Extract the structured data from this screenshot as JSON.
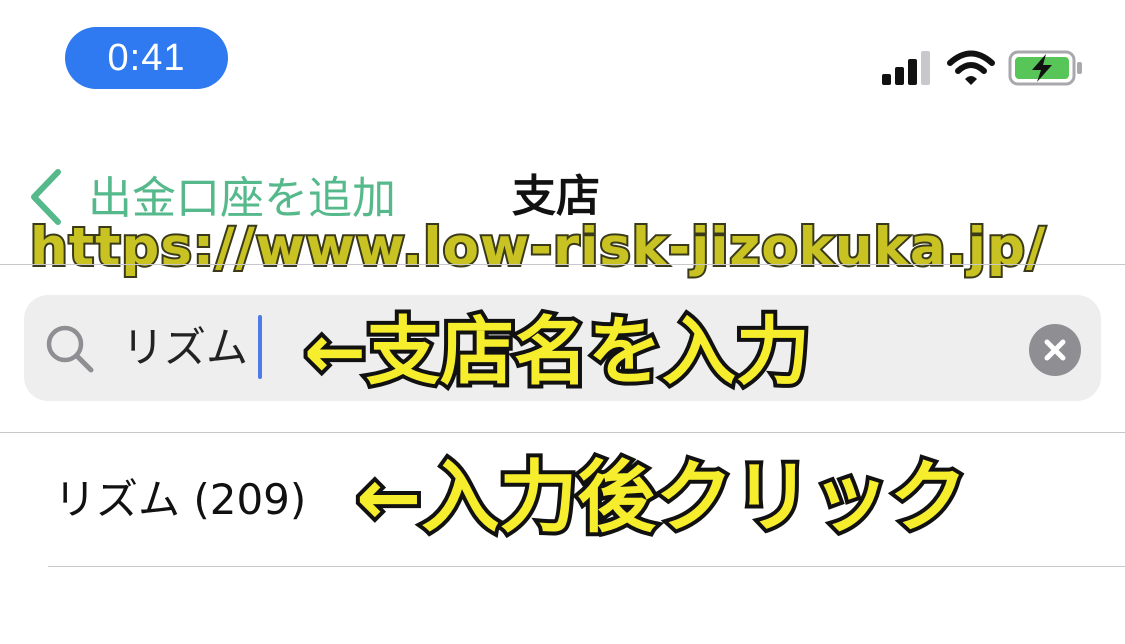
{
  "status_bar": {
    "time": "0:41",
    "icons": [
      "cellular-signal-icon",
      "wifi-icon",
      "battery-charging-icon"
    ],
    "time_pill_color": "#2f7af0"
  },
  "nav": {
    "back_label": "出金口座を追加",
    "title": "支店",
    "accent_color": "#55b98b"
  },
  "watermark": {
    "text": "https://www.low-risk-jizokuka.jp/"
  },
  "search": {
    "value": "リズム",
    "icon": "search-icon",
    "clear_icon": "close-icon"
  },
  "results": [
    {
      "label": "リズム (209)"
    }
  ],
  "annotations": {
    "search_hint": "←支店名を入力",
    "result_hint": "←入力後クリック",
    "text_color": "#f6ee2c"
  }
}
